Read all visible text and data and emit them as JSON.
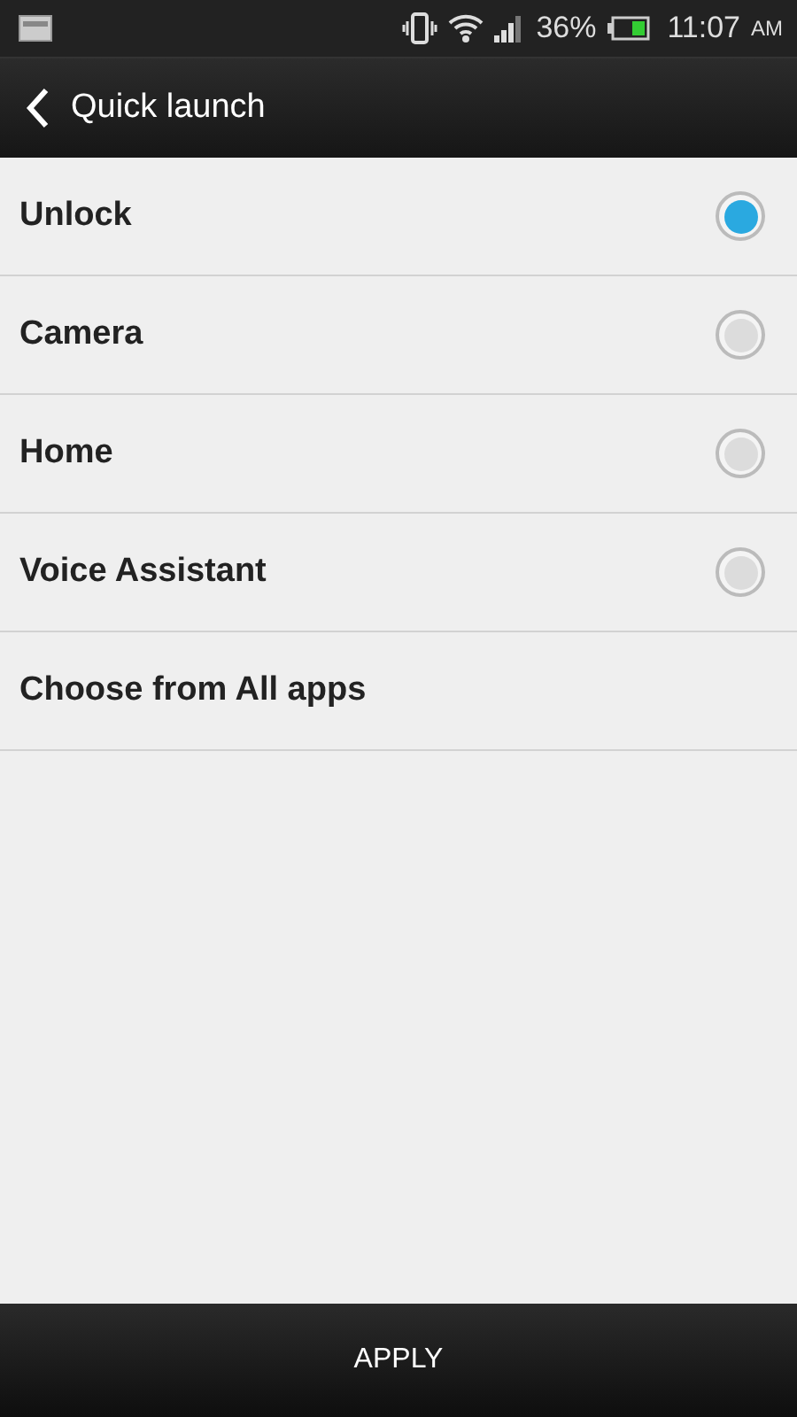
{
  "status_bar": {
    "battery": "36%",
    "time": "11:07",
    "meridiem": "AM"
  },
  "header": {
    "title": "Quick launch"
  },
  "options": [
    {
      "kind": "radio",
      "label": "Unlock",
      "selected": true
    },
    {
      "kind": "radio",
      "label": "Camera",
      "selected": false
    },
    {
      "kind": "radio",
      "label": "Home",
      "selected": false
    },
    {
      "kind": "radio",
      "label": "Voice Assistant",
      "selected": false
    },
    {
      "kind": "link",
      "label": "Choose from All apps"
    }
  ],
  "footer": {
    "button": "APPLY"
  }
}
